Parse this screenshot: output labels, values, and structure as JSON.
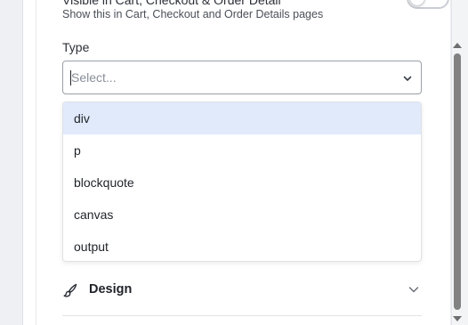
{
  "visibility": {
    "title": "Visible in Cart, Checkout & Order Detail",
    "description": "Show this in Cart, Checkout and Order Details pages",
    "toggle_on": false
  },
  "type_field": {
    "label": "Type",
    "placeholder": "Select...",
    "options": [
      {
        "label": "div",
        "highlighted": true
      },
      {
        "label": "p",
        "highlighted": false
      },
      {
        "label": "blockquote",
        "highlighted": false
      },
      {
        "label": "canvas",
        "highlighted": false
      },
      {
        "label": "output",
        "highlighted": false
      }
    ]
  },
  "design_section": {
    "label": "Design",
    "icon": "brush-icon"
  },
  "colors": {
    "highlight": "#e1eafb",
    "scrollbar_thumb": "#828282"
  }
}
